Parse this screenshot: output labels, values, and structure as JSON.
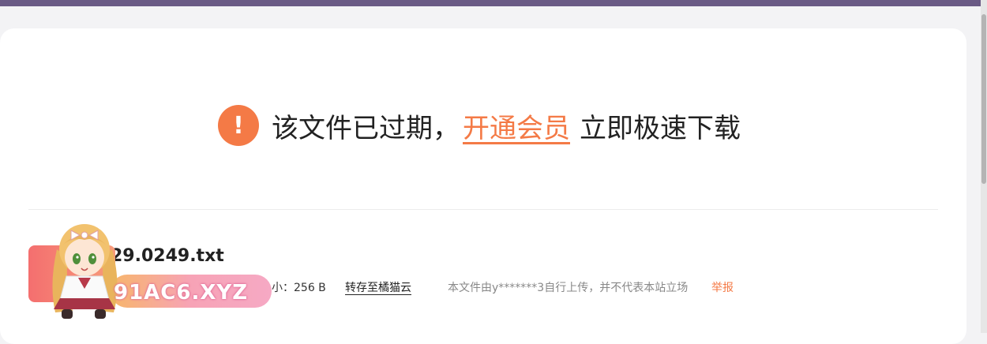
{
  "banner": {
    "alert_icon": "exclamation-icon",
    "alert_glyph": "!",
    "expired_text": "该文件已过期，",
    "vip_link": "开通会员",
    "suffix_text": "立即极速下载"
  },
  "file": {
    "name": "29.0249.txt",
    "size_text": "小：256 B",
    "save_link": "转存至橘猫云",
    "upload_note": "本文件由y*******3自行上传，并不代表本站立场",
    "report_link": "举报"
  },
  "watermark": {
    "text": "91AC6.XYZ"
  },
  "colors": {
    "accent": "#f47a46",
    "topbar": "#6a5a85"
  }
}
